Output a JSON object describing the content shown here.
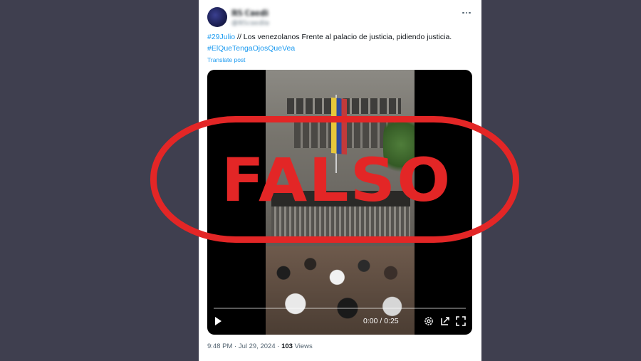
{
  "post": {
    "author_name": "ℝ𝕊 ℂ𝕠𝕖𝕕𝕚",
    "author_handle": "@ℝ𝕊𝕔𝕠𝕖𝕕𝕚𝕠",
    "hashtag_1": "#29Julio",
    "text_1": " // Los venezolanos Frente al palacio de justicia, pidiendo justicia. ",
    "hashtag_2": "#ElQueTengaOjosQueVea",
    "translate_label": "Translate post",
    "more_icon": "more-horizontal-icon"
  },
  "video": {
    "time_label": "0:00 / 0:25",
    "progress_fraction": 0,
    "icons": [
      "play-icon",
      "settings-icon",
      "picture-in-picture-icon",
      "fullscreen-icon"
    ]
  },
  "stamp": {
    "label": "FALSO",
    "color": "#e32626"
  },
  "footer": {
    "time": "9:48 PM",
    "separator": " · ",
    "date": "Jul 29, 2024",
    "views_count": "103",
    "views_label": " Views"
  },
  "colors": {
    "background": "#3f3f4f",
    "link": "#1d9bf0",
    "text": "#0f1419",
    "muted": "#536471"
  }
}
